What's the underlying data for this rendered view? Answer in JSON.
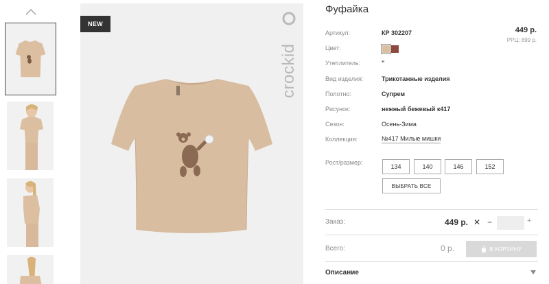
{
  "product": {
    "title": "Фуфайка",
    "badge": "NEW",
    "brand": "crockid",
    "price": "449 р.",
    "rrp": "РРЦ: 899 р."
  },
  "attributes": [
    {
      "label": "Артикул:",
      "value": "КР 302207"
    },
    {
      "label": "Цвет:",
      "value": ""
    },
    {
      "label": "Утеплитель:",
      "value": "\""
    },
    {
      "label": "Вид изделия:",
      "value": "Трикотажные изделия"
    },
    {
      "label": "Полотно:",
      "value": "Супрем"
    },
    {
      "label": "Рисунок:",
      "value": "нежный бежевый к417"
    },
    {
      "label": "Сезон:",
      "value": "Осень-Зима"
    },
    {
      "label": "Коллекция:",
      "value": "№417 Милые мишки"
    }
  ],
  "colors": [
    "#dbbf9f",
    "#8c4a3e"
  ],
  "sizes": {
    "label": "Рост/размер:",
    "options": [
      "134",
      "140",
      "146",
      "152"
    ],
    "select_all": "ВЫБРАТЬ ВСЕ"
  },
  "order": {
    "label": "Заказ:",
    "price": "449 р.",
    "quantity": ""
  },
  "total": {
    "label": "Всего:",
    "value": "0 р.",
    "cart_button": "В КОРЗИНУ"
  },
  "description": {
    "label": "Описание"
  },
  "icons": [
    "chevron-up-icon",
    "close-icon",
    "minus-icon",
    "plus-icon",
    "cart-icon",
    "chevron-down-icon"
  ]
}
